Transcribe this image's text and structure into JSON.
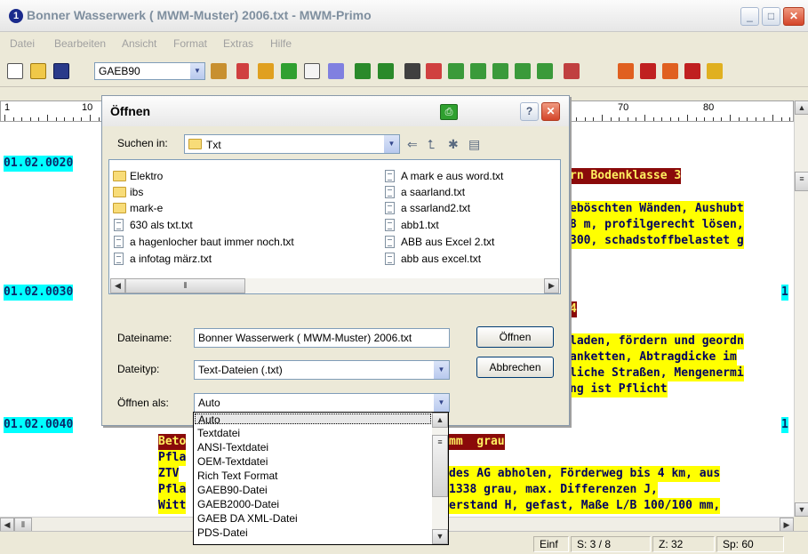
{
  "window": {
    "title": "Bonner Wasserwerk ( MWM-Muster) 2006.txt - MWM-Primo",
    "icon": "app-icon"
  },
  "menu": [
    "Datei",
    "Bearbeiten",
    "Ansicht",
    "Format",
    "Extras",
    "Hilfe"
  ],
  "toolbar": {
    "format_value": "GAEB90"
  },
  "ruler": {
    "numbers": [
      "1",
      "10",
      "70",
      "80"
    ]
  },
  "document": {
    "lines": [
      {
        "pos": "01.02.0020",
        "text": ""
      },
      {
        "text": "rn Bodenklasse 3"
      },
      {
        "text": "eböschten Wänden, Aushubt"
      },
      {
        "text": "8 m, profilgerecht lösen,"
      },
      {
        "text": "300, schadstoffbelastet g"
      },
      {
        "pos": "01.02.0030",
        "badge": "1"
      },
      {
        "text": "4"
      },
      {
        "text": "laden, fördern und geordn"
      },
      {
        "text": "anketten, Abtragdicke im"
      },
      {
        "text": "liche Straßen, Mengenermi"
      },
      {
        "text": "ng ist Pflicht"
      },
      {
        "pos": "01.02.0040",
        "badge": "1"
      },
      {
        "text": "Beto"
      },
      {
        "text": "mm  grau"
      },
      {
        "text": "Pfla"
      },
      {
        "text": "ZTV"
      },
      {
        "text": "des AG abholen, Förderweg bis 4 km, aus"
      },
      {
        "text": "Pfla"
      },
      {
        "text": "1338 grau, max. Differenzen J,"
      },
      {
        "text": "Witt"
      },
      {
        "text": "erstand H, gefast, Maße L/B 100/100 mm,"
      }
    ]
  },
  "status": {
    "mode": "Einf",
    "page": "S: 3 / 8",
    "col": "Z: 32",
    "sp": "Sp: 60"
  },
  "dialog": {
    "title": "Öffnen",
    "look_in_label": "Suchen in:",
    "look_in_value": "Txt",
    "folders": [
      "Elektro",
      "ibs",
      "mark-e"
    ],
    "files_col1": [
      "630 als txt.txt",
      "a hagenlocher baut immer noch.txt",
      "a infotag märz.txt"
    ],
    "files_col2": [
      "A mark e aus word.txt",
      "a saarland.txt",
      "a ssarland2.txt",
      "abb1.txt",
      "ABB aus Excel 2.txt",
      "abb aus excel.txt"
    ],
    "filename_label": "Dateiname:",
    "filename_value": "Bonner Wasserwerk ( MWM-Muster) 2006.txt",
    "filetype_label": "Dateityp:",
    "filetype_value": "Text-Dateien (.txt)",
    "openas_label": "Öffnen als:",
    "openas_value": "Auto",
    "open_button": "Öffnen",
    "cancel_button": "Abbrechen",
    "openas_options": [
      "Auto",
      "Textdatei",
      "ANSI-Textdatei",
      "OEM-Textdatei",
      "Rich Text Format",
      "GAEB90-Datei",
      "GAEB2000-Datei",
      "GAEB DA XML-Datei",
      "PDS-Datei"
    ]
  }
}
